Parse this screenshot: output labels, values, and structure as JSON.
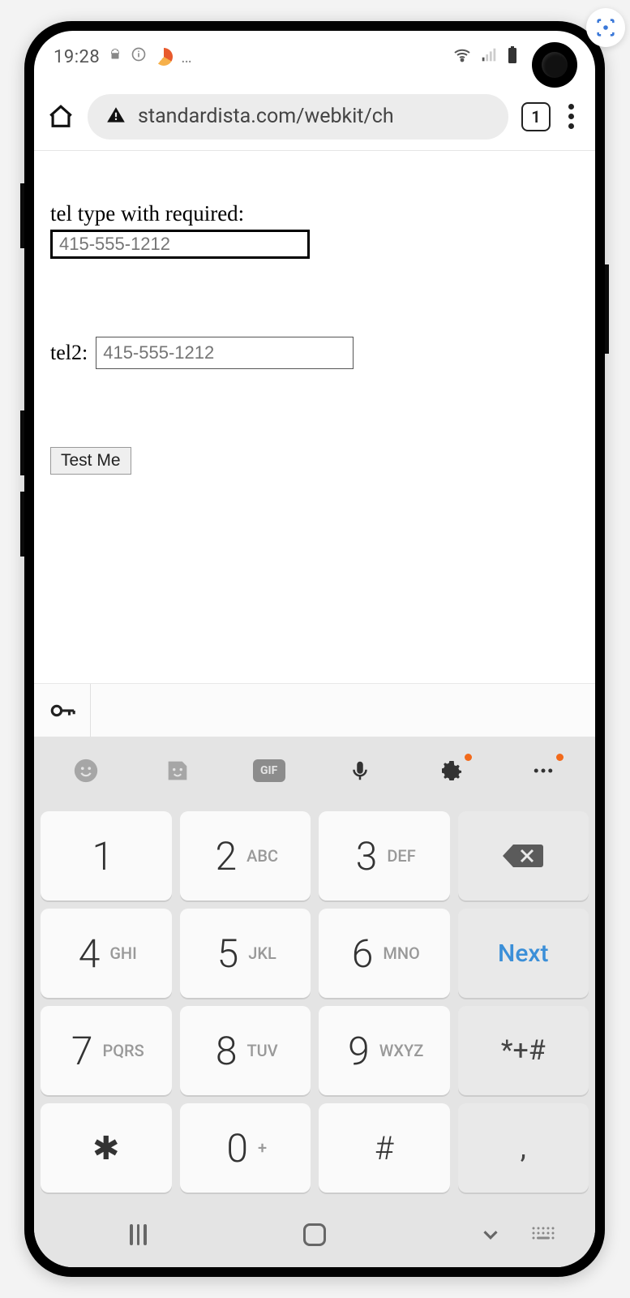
{
  "status": {
    "clock": "19:28",
    "icons": {
      "android": "android-icon",
      "info": "info-icon",
      "swirl": "swirl-icon",
      "more": "…"
    }
  },
  "browser": {
    "url": "standardista.com/webkit/ch",
    "tab_count": "1"
  },
  "page": {
    "field1_label": "tel type with required:",
    "field1_placeholder": "415-555-1212",
    "field2_label": "tel2:",
    "field2_placeholder": "415-555-1212",
    "test_button": "Test Me"
  },
  "keyboard": {
    "toolbar": {
      "gif": "GIF"
    },
    "keys": [
      [
        {
          "d": "1",
          "l": ""
        },
        {
          "d": "2",
          "l": "ABC"
        },
        {
          "d": "3",
          "l": "DEF"
        },
        {
          "type": "backspace"
        }
      ],
      [
        {
          "d": "4",
          "l": "GHI"
        },
        {
          "d": "5",
          "l": "JKL"
        },
        {
          "d": "6",
          "l": "MNO"
        },
        {
          "type": "next",
          "label": "Next"
        }
      ],
      [
        {
          "d": "7",
          "l": "PQRS"
        },
        {
          "d": "8",
          "l": "TUV"
        },
        {
          "d": "9",
          "l": "WXYZ"
        },
        {
          "type": "sym",
          "label": "*+#"
        }
      ],
      [
        {
          "d": "✱",
          "l": ""
        },
        {
          "d": "0",
          "l": "+"
        },
        {
          "d": "#",
          "l": ""
        },
        {
          "type": "comma",
          "label": ","
        }
      ]
    ]
  }
}
